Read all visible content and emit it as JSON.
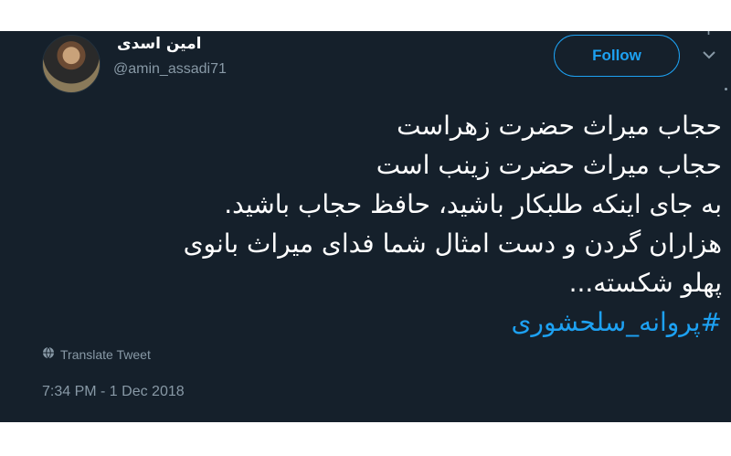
{
  "tweet": {
    "author": {
      "display_name": "امین اسدی",
      "handle": "@amin_assadi71"
    },
    "follow_label": "Follow",
    "lines": [
      "حجاب میراث حضرت زهراست",
      "حجاب میراث حضرت زینب است",
      "به جای اینکه طلبکار باشید، حافظ حجاب باشید.",
      "هزاران گردن و دست امثال شما فدای میراث بانوی",
      "پهلو شکسته..."
    ],
    "hashtag": "#پروانه_سلحشوری",
    "translate_label": "Translate Tweet",
    "timestamp": "7:34 PM - 1 Dec 2018"
  },
  "colors": {
    "background": "#15202b",
    "accent": "#1da1f2",
    "muted": "#8899a6",
    "text": "#ffffff"
  },
  "icons": [
    "globe-icon",
    "chevron-down-icon"
  ]
}
